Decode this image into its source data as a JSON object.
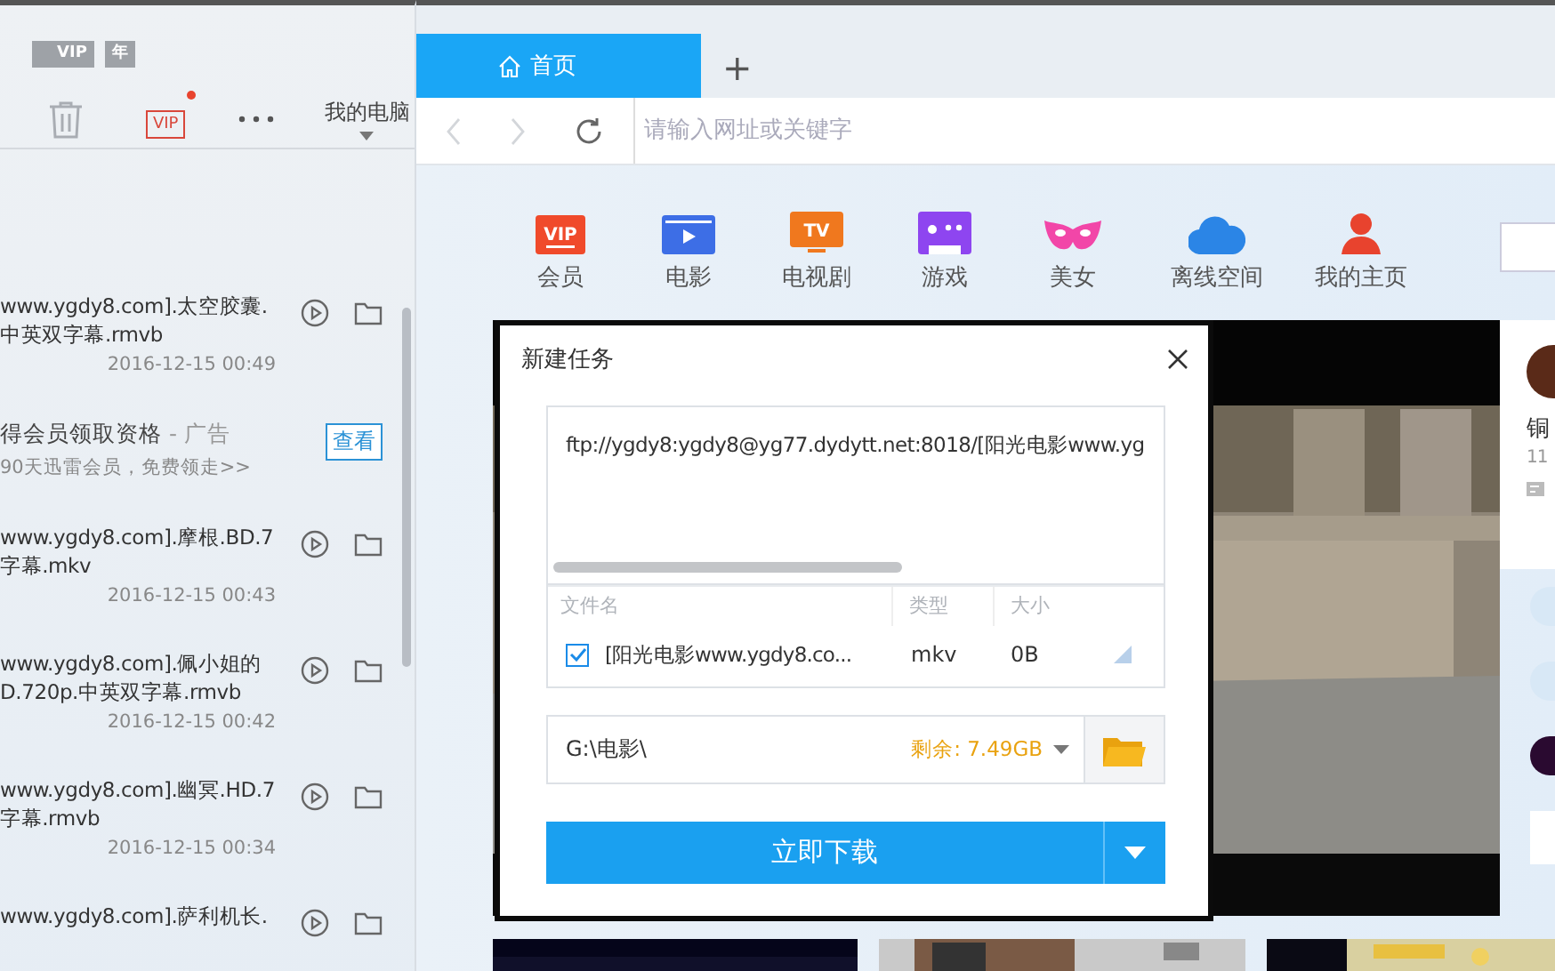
{
  "sidebar": {
    "badges": [
      {
        "kind": "vip",
        "label": "VIP"
      },
      {
        "kind": "year",
        "label": "年"
      }
    ],
    "toolbar": {
      "vip_label": "VIP",
      "vip_dot": true,
      "location": "我的电脑"
    },
    "downloads": [
      {
        "kind": "file",
        "lines": [
          "www.ygdy8.com].太空胶囊.",
          "中英双字幕.rmvb"
        ],
        "time": "2016-12-15 00:49"
      },
      {
        "kind": "ad",
        "title": "得会员领取资格",
        "tag": "- 广告",
        "subtitle": "90天迅雷会员，免费领走>>",
        "button": "查看"
      },
      {
        "kind": "file",
        "lines": [
          "www.ygdy8.com].摩根.BD.7",
          "字幕.mkv"
        ],
        "time": "2016-12-15 00:43"
      },
      {
        "kind": "file",
        "lines": [
          "www.ygdy8.com].佩小姐的",
          "D.720p.中英双字幕.rmvb"
        ],
        "time": "2016-12-15 00:42"
      },
      {
        "kind": "file",
        "lines": [
          "www.ygdy8.com].幽冥.HD.7",
          "字幕.rmvb"
        ],
        "time": "2016-12-15 00:34"
      },
      {
        "kind": "file",
        "lines": [
          "www.ygdy8.com].萨利机长."
        ]
      }
    ]
  },
  "tabs": [
    {
      "label": "首页",
      "selected": true
    }
  ],
  "new_tab": "+",
  "address_bar": {
    "placeholder": "请输入网址或关键字"
  },
  "nav": [
    {
      "kind": "vip",
      "icon_text": "VIP",
      "label": "会员"
    },
    {
      "kind": "movie",
      "label": "电影"
    },
    {
      "kind": "tv",
      "icon_text": "TV",
      "label": "电视剧"
    },
    {
      "kind": "game",
      "label": "游戏"
    },
    {
      "kind": "mask",
      "label": "美女"
    },
    {
      "kind": "cloud",
      "label": "离线空间"
    },
    {
      "kind": "person",
      "label": "我的主页"
    }
  ],
  "side_card": {
    "title": "铜",
    "meta": "11"
  },
  "dialog": {
    "title": "新建任务",
    "url": "ftp://ygdy8:ygdy8@yg77.dydytt.net:8018/[阳光电影www.yg",
    "columns": [
      "文件名",
      "类型",
      "大小"
    ],
    "files": [
      {
        "checked": true,
        "name": "[阳光电影www.ygdy8.co...",
        "type": "mkv",
        "size": "0B"
      }
    ],
    "path": "G:\\电影\\",
    "free": "剩余: 7.49GB",
    "download": "立即下载"
  }
}
